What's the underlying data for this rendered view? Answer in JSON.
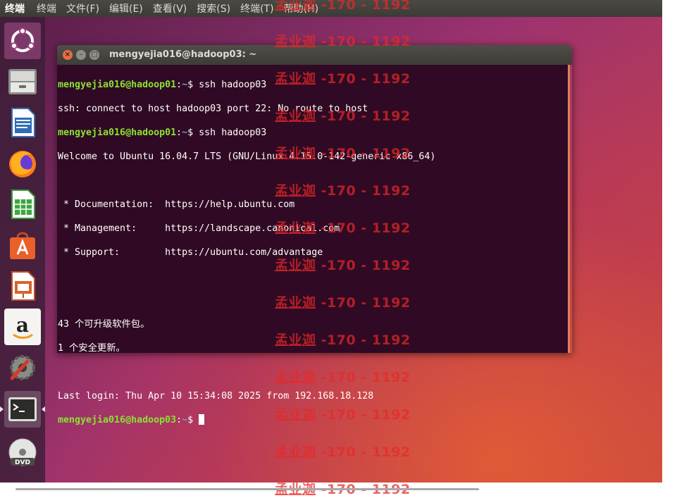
{
  "topbar": {
    "app_name": "终端",
    "menus": [
      "终端",
      "文件(F)",
      "编辑(E)",
      "查看(V)",
      "搜索(S)",
      "终端(T)",
      "帮助(H)"
    ]
  },
  "launcher": {
    "items": [
      {
        "name": "ubuntu-dash-icon"
      },
      {
        "name": "files-icon"
      },
      {
        "name": "libreoffice-writer-icon"
      },
      {
        "name": "firefox-icon"
      },
      {
        "name": "libreoffice-calc-icon"
      },
      {
        "name": "software-center-icon"
      },
      {
        "name": "libreoffice-impress-icon"
      },
      {
        "name": "amazon-icon"
      },
      {
        "name": "system-settings-icon"
      },
      {
        "name": "terminal-icon"
      },
      {
        "name": "dvd-icon"
      }
    ]
  },
  "window": {
    "title": "mengyejia016@hadoop03: ~",
    "close_glyph": "×",
    "min_glyph": "–",
    "max_glyph": "□"
  },
  "terminal": {
    "prompt_user1": "mengyejia016@hadoop01",
    "prompt_user3": "mengyejia016@hadoop03",
    "prompt_path": "~",
    "cmd1": "ssh hadoop03",
    "out1": "ssh: connect to host hadoop03 port 22: No route to host",
    "cmd2": "ssh hadoop03",
    "welcome": "Welcome to Ubuntu 16.04.7 LTS (GNU/Linux 4.15.0-142-generic x86_64)",
    "doc": " * Documentation:  https://help.ubuntu.com",
    "mgmt": " * Management:     https://landscape.canonical.com",
    "support": " * Support:        https://ubuntu.com/advantage",
    "upgrades": "43 个可升级软件包。",
    "security": "1 个安全更新。",
    "last_login": "Last login: Thu Apr 10 15:34:08 2025 from 192.168.18.128"
  },
  "watermark": {
    "name": "孟业迦",
    "code": "-170 - 1192"
  }
}
